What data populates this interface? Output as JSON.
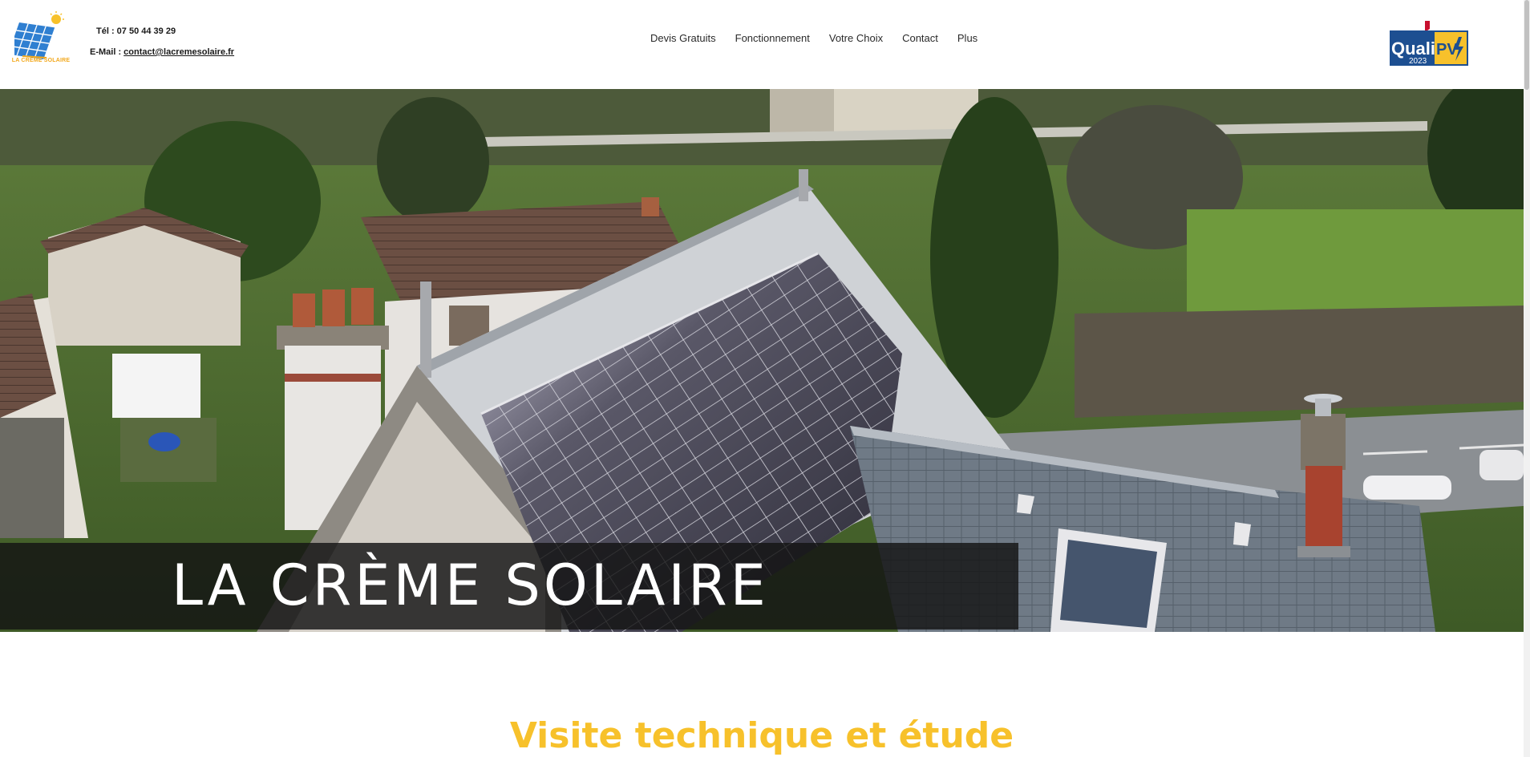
{
  "header": {
    "logo_text": "LA CRÈME SOLAIRE",
    "phone": "Tél : 07 50 44 39 29",
    "email_label": "E-Mail : ",
    "email": "contact@lacremesolaire.fr",
    "qualipv_brand": "Quali",
    "qualipv_suffix": "PV",
    "qualipv_year": "2023"
  },
  "nav": {
    "items": [
      "Devis Gratuits",
      "Fonctionnement",
      "Votre Choix",
      "Contact",
      "Plus"
    ]
  },
  "hero": {
    "title": "LA CRÈME SOLAIRE"
  },
  "section": {
    "heading": "Visite technique et étude"
  },
  "colors": {
    "accent_yellow": "#f7c12b",
    "logo_orange": "#f2a81d",
    "qualipv_blue": "#1d4f91",
    "banner_bg": "#141414"
  },
  "icons": {
    "logo": "solar-panel-sun-icon",
    "certification": "qualipv-badge-icon"
  }
}
